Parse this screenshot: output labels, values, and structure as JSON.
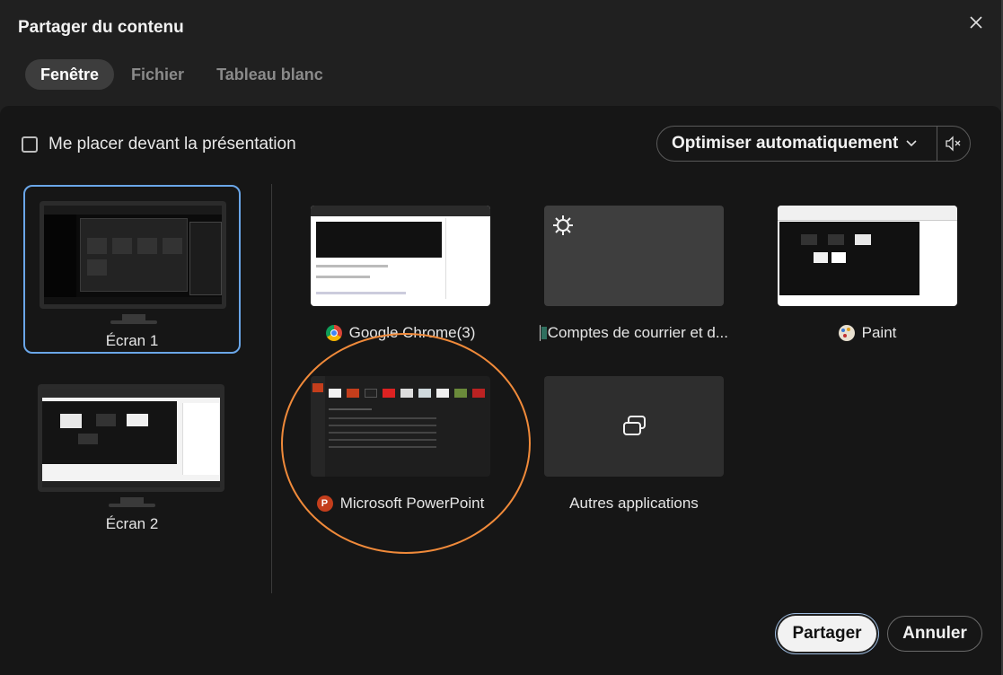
{
  "dialog": {
    "title": "Partager du contenu"
  },
  "tabs": [
    {
      "label": "Fenêtre",
      "active": true
    },
    {
      "label": "Fichier",
      "active": false
    },
    {
      "label": "Tableau blanc",
      "active": false
    }
  ],
  "options": {
    "presenter_checkbox_label": "Me placer devant la présentation",
    "presenter_checked": false,
    "optimize_label": "Optimiser automatiquement"
  },
  "screens": [
    {
      "label": "Écran 1",
      "selected": true
    },
    {
      "label": "Écran 2",
      "selected": false
    }
  ],
  "apps": [
    {
      "label": "Google Chrome(3)",
      "icon": "chrome-icon"
    },
    {
      "label": "Comptes de courrier et d...",
      "icon": "mail-accounts-icon"
    },
    {
      "label": "Paint",
      "icon": "paint-icon"
    },
    {
      "label": "Microsoft PowerPoint",
      "icon": "powerpoint-icon"
    },
    {
      "label": "Autres applications",
      "icon": "windows-stack-icon"
    }
  ],
  "buttons": {
    "share": "Partager",
    "cancel": "Annuler"
  },
  "colors": {
    "selection": "#6aa6e8",
    "annotation": "#f08a3a"
  }
}
